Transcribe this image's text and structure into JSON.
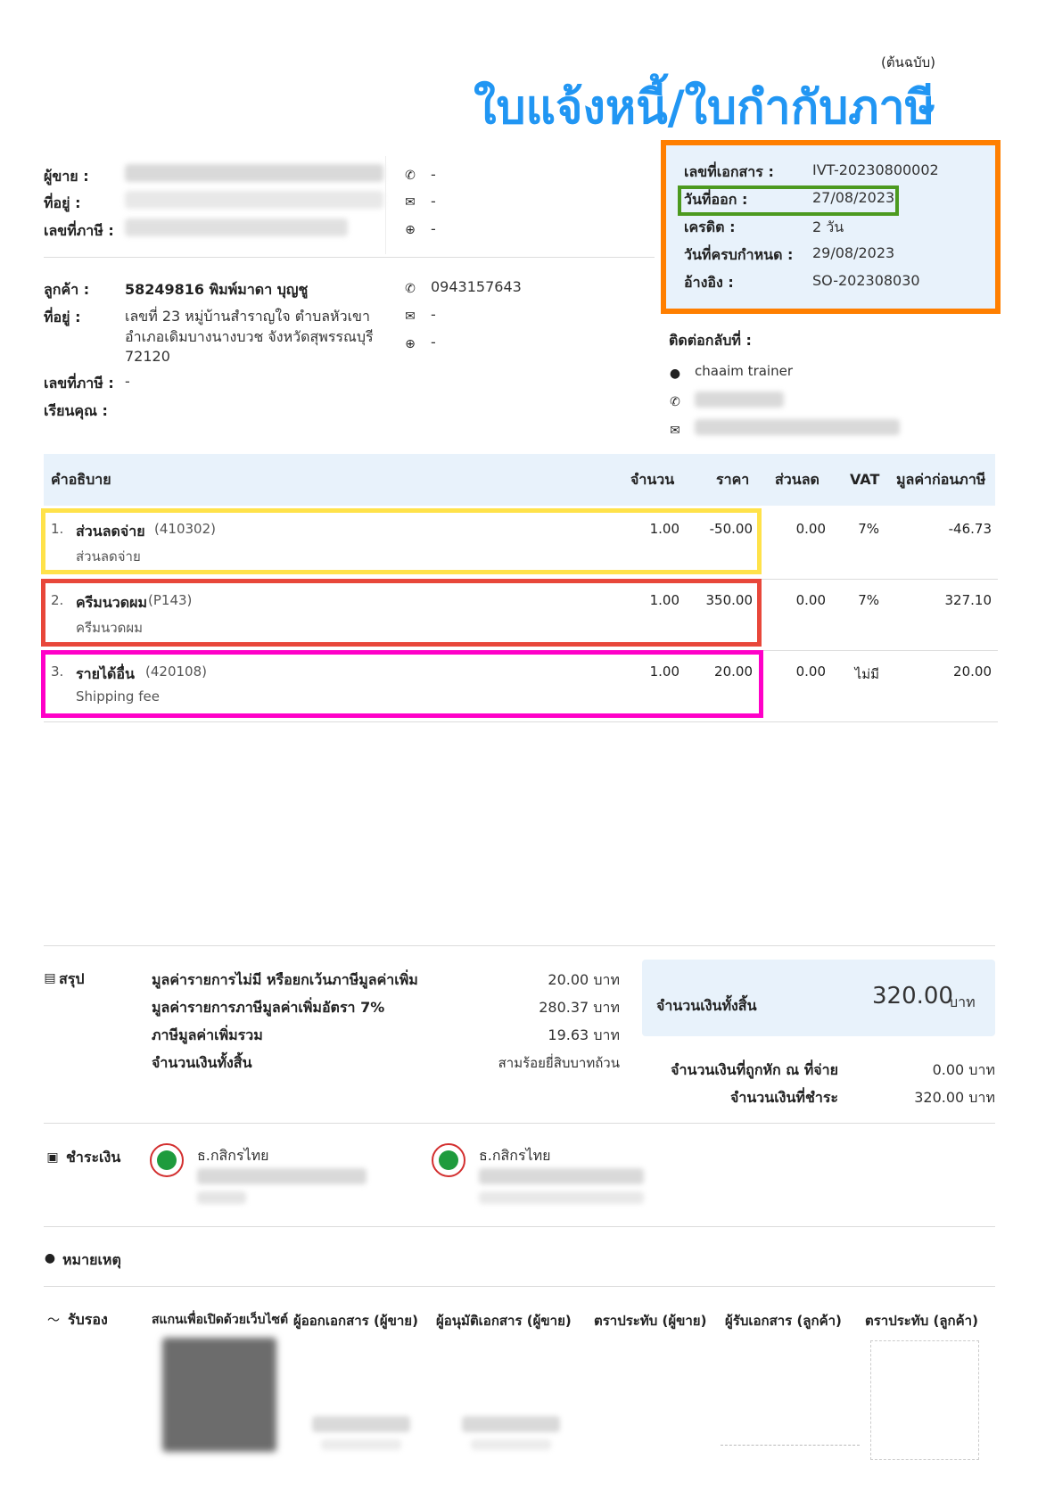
{
  "header": {
    "copy_label": "(ต้นฉบับ)",
    "title": "ใบแจ้งหนี้/ใบกำกับภาษี"
  },
  "seller": {
    "seller_label": "ผู้ขาย :",
    "address_label": "ที่อยู่ :",
    "taxid_label": "เลขที่ภาษี :",
    "phone": "-",
    "email": "-",
    "web": "-"
  },
  "customer": {
    "customer_label": "ลูกค้า :",
    "name": "58249816 พิมพ์มาดา บุญชู",
    "address_label": "ที่อยู่ :",
    "address_line1": "เลขที่ 23 หมู่บ้านสำราญใจ  ตำบลหัวเขา",
    "address_line2": "อำเภอเดิมบางนางบวช จังหวัดสุพรรณบุรี",
    "address_line3": "72120",
    "taxid_label": "เลขที่ภาษี :",
    "taxid": "-",
    "attn_label": "เรียนคุณ :",
    "phone": "0943157643",
    "email": "-",
    "web": "-"
  },
  "docinfo": [
    {
      "label": "เลขที่เอกสาร :",
      "value": "IVT-20230800002"
    },
    {
      "label": "วันที่ออก :",
      "value": "27/08/2023"
    },
    {
      "label": "เครดิต :",
      "value": "2 วัน"
    },
    {
      "label": "วันที่ครบกำหนด :",
      "value": "29/08/2023"
    },
    {
      "label": "อ้างอิง :",
      "value": "SO-202308030"
    }
  ],
  "contact": {
    "label": "ติดต่อกลับที่ :",
    "name": "chaaim trainer"
  },
  "table": {
    "headers": {
      "desc": "คำอธิบาย",
      "qty": "จำนวน",
      "price": "ราคา",
      "discount": "ส่วนลด",
      "vat": "VAT",
      "pretax": "มูลค่าก่อนภาษี"
    },
    "rows": [
      {
        "no": "1.",
        "name": "ส่วนลดจ่าย",
        "code": "(410302)",
        "sub": "ส่วนลดจ่าย",
        "qty": "1.00",
        "price": "-50.00",
        "discount": "0.00",
        "vat": "7%",
        "pretax": "-46.73"
      },
      {
        "no": "2.",
        "name": "ครีมนวดผม",
        "code": "(P143)",
        "sub": "ครีมนวดผม",
        "qty": "1.00",
        "price": "350.00",
        "discount": "0.00",
        "vat": "7%",
        "pretax": "327.10"
      },
      {
        "no": "3.",
        "name": "รายได้อื่น",
        "code": "(420108)",
        "sub": "Shipping fee",
        "qty": "1.00",
        "price": "20.00",
        "discount": "0.00",
        "vat": "ไม่มี",
        "pretax": "20.00"
      }
    ]
  },
  "summary": {
    "title": "สรุป",
    "lines": [
      {
        "label": "มูลค่ารายการไม่มี หรือยกเว้นภาษีมูลค่าเพิ่ม",
        "value": "20.00 บาท"
      },
      {
        "label": "มูลค่ารายการภาษีมูลค่าเพิ่มอัตรา 7%",
        "value": "280.37 บาท"
      },
      {
        "label": "ภาษีมูลค่าเพิ่มรวม",
        "value": "19.63 บาท"
      },
      {
        "label": "จำนวนเงินทั้งสิ้น",
        "value": "สามร้อยยี่สิบบาทถ้วน"
      }
    ],
    "total_label": "จำนวนเงินทั้งสิ้น",
    "total_value": "320.00",
    "total_unit": "บาท",
    "withheld_label": "จำนวนเงินที่ถูกหัก ณ ที่จ่าย",
    "withheld_value": "0.00 บาท",
    "paid_label": "จำนวนเงินที่ชำระ",
    "paid_value": "320.00 บาท"
  },
  "payment": {
    "title": "ชำระเงิน",
    "banks": [
      {
        "name": "ธ.กสิกรไทย"
      },
      {
        "name": "ธ.กสิกรไทย"
      }
    ]
  },
  "notes": {
    "title": "หมายเหตุ"
  },
  "approval": {
    "title": "รับรอง",
    "columns": [
      "สแกนเพื่อเปิดด้วยเว็บไซต์",
      "ผู้ออกเอกสาร (ผู้ขาย)",
      "ผู้อนุมัติเอกสาร (ผู้ขาย)",
      "ตราประทับ (ผู้ขาย)",
      "ผู้รับเอกสาร (ลูกค้า)",
      "ตราประทับ (ลูกค้า)"
    ]
  },
  "colors": {
    "title_blue": "#2196f3",
    "header_bg": "#e8f2fb",
    "orange": "#ff7f00",
    "green": "#4c9a1f",
    "yellow": "#ffe24a",
    "red": "#e8473a",
    "pink": "#ff00c8"
  }
}
